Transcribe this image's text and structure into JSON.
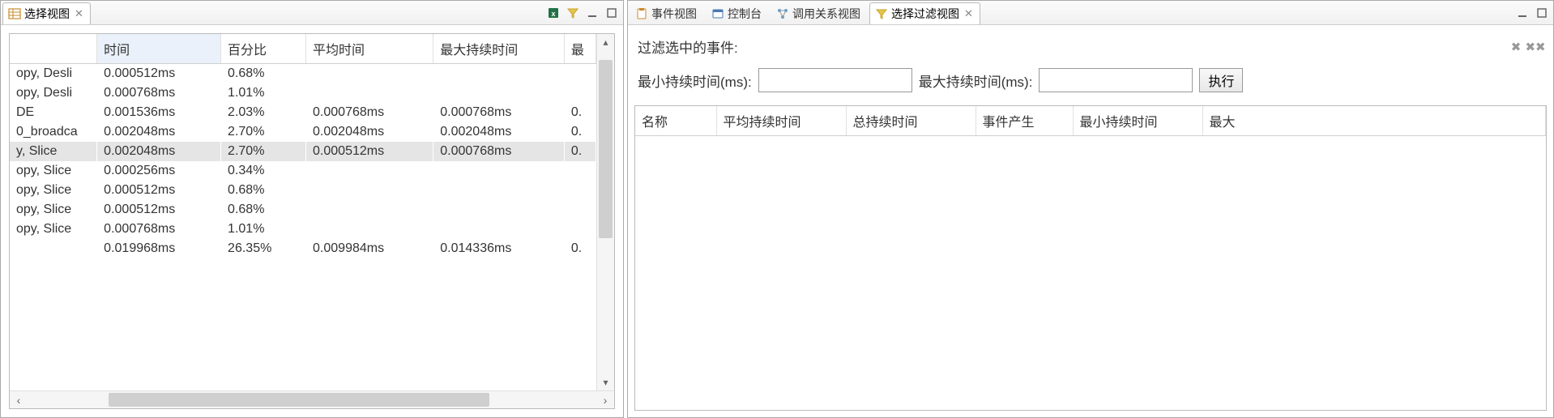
{
  "left_panel": {
    "tab_title": "选择视图",
    "columns": {
      "name": "",
      "time": "时间",
      "percent": "百分比",
      "avg": "平均时间",
      "max": "最大持续时间",
      "min_partial": "最"
    },
    "rows": [
      {
        "name": "opy, Desli",
        "time": "0.000512ms",
        "percent": "0.68%",
        "avg": "",
        "max": "",
        "min": ""
      },
      {
        "name": "opy, Desli",
        "time": "0.000768ms",
        "percent": "1.01%",
        "avg": "",
        "max": "",
        "min": ""
      },
      {
        "name": "DE",
        "time": "0.001536ms",
        "percent": "2.03%",
        "avg": "0.000768ms",
        "max": "0.000768ms",
        "min": "0."
      },
      {
        "name": "0_broadca",
        "time": "0.002048ms",
        "percent": "2.70%",
        "avg": "0.002048ms",
        "max": "0.002048ms",
        "min": "0."
      },
      {
        "name": "y, Slice",
        "time": "0.002048ms",
        "percent": "2.70%",
        "avg": "0.000512ms",
        "max": "0.000768ms",
        "min": "0.",
        "selected": true
      },
      {
        "name": "opy, Slice",
        "time": "0.000256ms",
        "percent": "0.34%",
        "avg": "",
        "max": "",
        "min": ""
      },
      {
        "name": "opy, Slice",
        "time": "0.000512ms",
        "percent": "0.68%",
        "avg": "",
        "max": "",
        "min": ""
      },
      {
        "name": "opy, Slice",
        "time": "0.000512ms",
        "percent": "0.68%",
        "avg": "",
        "max": "",
        "min": ""
      },
      {
        "name": "opy, Slice",
        "time": "0.000768ms",
        "percent": "1.01%",
        "avg": "",
        "max": "",
        "min": ""
      },
      {
        "name": "",
        "time": "0.019968ms",
        "percent": "26.35%",
        "avg": "0.009984ms",
        "max": "0.014336ms",
        "min": "0."
      }
    ]
  },
  "right_panel": {
    "tabs": [
      {
        "id": "events",
        "label": "事件视图"
      },
      {
        "id": "console",
        "label": "控制台"
      },
      {
        "id": "callrel",
        "label": "调用关系视图"
      },
      {
        "id": "filter",
        "label": "选择过滤视图",
        "active": true
      }
    ],
    "filter_title": "过滤选中的事件:",
    "min_label": "最小持续时间(ms):",
    "max_label": "最大持续时间(ms):",
    "min_value": "",
    "max_value": "",
    "exec_label": "执行",
    "columns": {
      "name": "名称",
      "avg": "平均持续时间",
      "total": "总持续时间",
      "events": "事件产生",
      "min": "最小持续时间",
      "max_partial": "最大"
    }
  }
}
